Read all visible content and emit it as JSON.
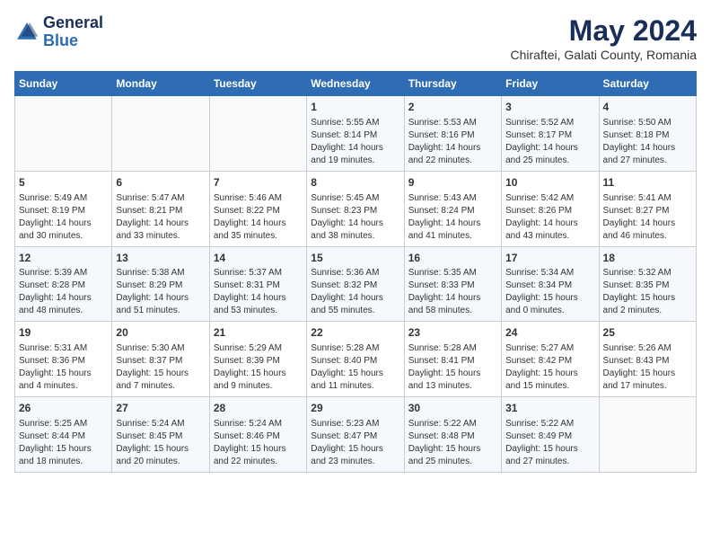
{
  "logo": {
    "general": "General",
    "blue": "Blue"
  },
  "title": "May 2024",
  "subtitle": "Chiraftei, Galati County, Romania",
  "days_of_week": [
    "Sunday",
    "Monday",
    "Tuesday",
    "Wednesday",
    "Thursday",
    "Friday",
    "Saturday"
  ],
  "weeks": [
    [
      {
        "day": "",
        "info": ""
      },
      {
        "day": "",
        "info": ""
      },
      {
        "day": "",
        "info": ""
      },
      {
        "day": "1",
        "info": "Sunrise: 5:55 AM\nSunset: 8:14 PM\nDaylight: 14 hours\nand 19 minutes."
      },
      {
        "day": "2",
        "info": "Sunrise: 5:53 AM\nSunset: 8:16 PM\nDaylight: 14 hours\nand 22 minutes."
      },
      {
        "day": "3",
        "info": "Sunrise: 5:52 AM\nSunset: 8:17 PM\nDaylight: 14 hours\nand 25 minutes."
      },
      {
        "day": "4",
        "info": "Sunrise: 5:50 AM\nSunset: 8:18 PM\nDaylight: 14 hours\nand 27 minutes."
      }
    ],
    [
      {
        "day": "5",
        "info": "Sunrise: 5:49 AM\nSunset: 8:19 PM\nDaylight: 14 hours\nand 30 minutes."
      },
      {
        "day": "6",
        "info": "Sunrise: 5:47 AM\nSunset: 8:21 PM\nDaylight: 14 hours\nand 33 minutes."
      },
      {
        "day": "7",
        "info": "Sunrise: 5:46 AM\nSunset: 8:22 PM\nDaylight: 14 hours\nand 35 minutes."
      },
      {
        "day": "8",
        "info": "Sunrise: 5:45 AM\nSunset: 8:23 PM\nDaylight: 14 hours\nand 38 minutes."
      },
      {
        "day": "9",
        "info": "Sunrise: 5:43 AM\nSunset: 8:24 PM\nDaylight: 14 hours\nand 41 minutes."
      },
      {
        "day": "10",
        "info": "Sunrise: 5:42 AM\nSunset: 8:26 PM\nDaylight: 14 hours\nand 43 minutes."
      },
      {
        "day": "11",
        "info": "Sunrise: 5:41 AM\nSunset: 8:27 PM\nDaylight: 14 hours\nand 46 minutes."
      }
    ],
    [
      {
        "day": "12",
        "info": "Sunrise: 5:39 AM\nSunset: 8:28 PM\nDaylight: 14 hours\nand 48 minutes."
      },
      {
        "day": "13",
        "info": "Sunrise: 5:38 AM\nSunset: 8:29 PM\nDaylight: 14 hours\nand 51 minutes."
      },
      {
        "day": "14",
        "info": "Sunrise: 5:37 AM\nSunset: 8:31 PM\nDaylight: 14 hours\nand 53 minutes."
      },
      {
        "day": "15",
        "info": "Sunrise: 5:36 AM\nSunset: 8:32 PM\nDaylight: 14 hours\nand 55 minutes."
      },
      {
        "day": "16",
        "info": "Sunrise: 5:35 AM\nSunset: 8:33 PM\nDaylight: 14 hours\nand 58 minutes."
      },
      {
        "day": "17",
        "info": "Sunrise: 5:34 AM\nSunset: 8:34 PM\nDaylight: 15 hours\nand 0 minutes."
      },
      {
        "day": "18",
        "info": "Sunrise: 5:32 AM\nSunset: 8:35 PM\nDaylight: 15 hours\nand 2 minutes."
      }
    ],
    [
      {
        "day": "19",
        "info": "Sunrise: 5:31 AM\nSunset: 8:36 PM\nDaylight: 15 hours\nand 4 minutes."
      },
      {
        "day": "20",
        "info": "Sunrise: 5:30 AM\nSunset: 8:37 PM\nDaylight: 15 hours\nand 7 minutes."
      },
      {
        "day": "21",
        "info": "Sunrise: 5:29 AM\nSunset: 8:39 PM\nDaylight: 15 hours\nand 9 minutes."
      },
      {
        "day": "22",
        "info": "Sunrise: 5:28 AM\nSunset: 8:40 PM\nDaylight: 15 hours\nand 11 minutes."
      },
      {
        "day": "23",
        "info": "Sunrise: 5:28 AM\nSunset: 8:41 PM\nDaylight: 15 hours\nand 13 minutes."
      },
      {
        "day": "24",
        "info": "Sunrise: 5:27 AM\nSunset: 8:42 PM\nDaylight: 15 hours\nand 15 minutes."
      },
      {
        "day": "25",
        "info": "Sunrise: 5:26 AM\nSunset: 8:43 PM\nDaylight: 15 hours\nand 17 minutes."
      }
    ],
    [
      {
        "day": "26",
        "info": "Sunrise: 5:25 AM\nSunset: 8:44 PM\nDaylight: 15 hours\nand 18 minutes."
      },
      {
        "day": "27",
        "info": "Sunrise: 5:24 AM\nSunset: 8:45 PM\nDaylight: 15 hours\nand 20 minutes."
      },
      {
        "day": "28",
        "info": "Sunrise: 5:24 AM\nSunset: 8:46 PM\nDaylight: 15 hours\nand 22 minutes."
      },
      {
        "day": "29",
        "info": "Sunrise: 5:23 AM\nSunset: 8:47 PM\nDaylight: 15 hours\nand 23 minutes."
      },
      {
        "day": "30",
        "info": "Sunrise: 5:22 AM\nSunset: 8:48 PM\nDaylight: 15 hours\nand 25 minutes."
      },
      {
        "day": "31",
        "info": "Sunrise: 5:22 AM\nSunset: 8:49 PM\nDaylight: 15 hours\nand 27 minutes."
      },
      {
        "day": "",
        "info": ""
      }
    ]
  ]
}
